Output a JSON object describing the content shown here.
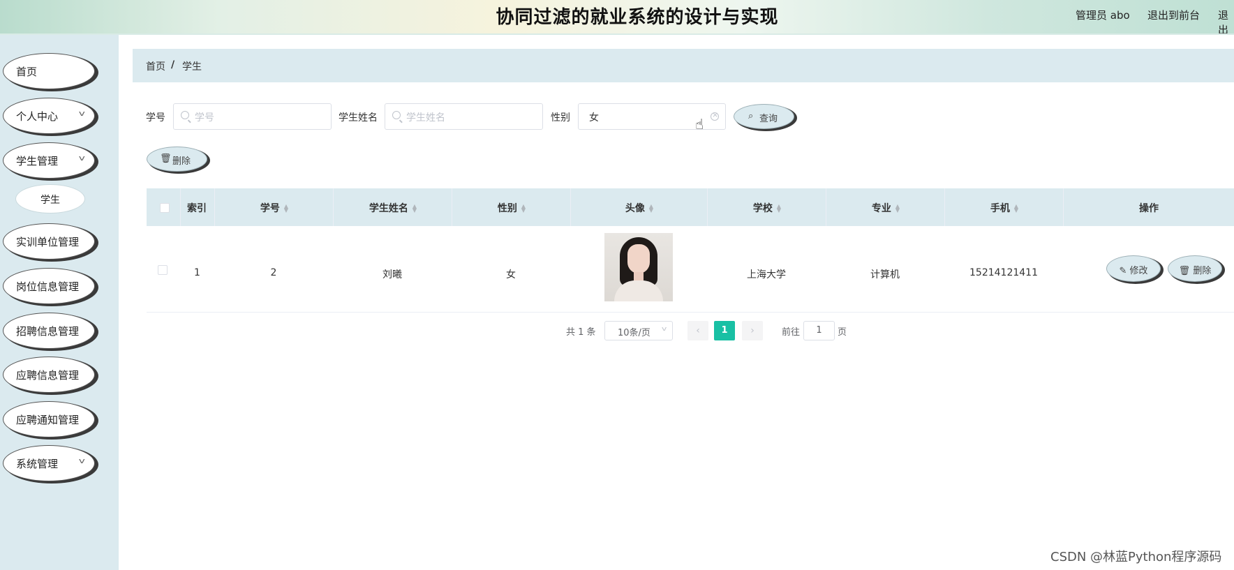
{
  "header": {
    "title": "协同过滤的就业系统的设计与实现",
    "user": "管理员 abo",
    "links": [
      "退出到前台",
      "退出"
    ]
  },
  "sidebar": {
    "items": [
      {
        "label": "首页",
        "expandable": false
      },
      {
        "label": "个人中心",
        "expandable": true
      },
      {
        "label": "学生管理",
        "expandable": true
      },
      {
        "label": "实训单位管理",
        "expandable": false
      },
      {
        "label": "岗位信息管理",
        "expandable": false
      },
      {
        "label": "招聘信息管理",
        "expandable": false
      },
      {
        "label": "应聘信息管理",
        "expandable": false
      },
      {
        "label": "应聘通知管理",
        "expandable": false
      },
      {
        "label": "系统管理",
        "expandable": true
      }
    ],
    "sub_item": "学生"
  },
  "breadcrumb": {
    "home": "首页",
    "separator": "/",
    "current": "学生"
  },
  "search": {
    "student_no_label": "学号",
    "student_no_placeholder": "学号",
    "name_label": "学生姓名",
    "name_placeholder": "学生姓名",
    "gender_label": "性别",
    "gender_value": "女",
    "query_button": "查询"
  },
  "toolbar": {
    "delete_button": "删除"
  },
  "table": {
    "headers": [
      "索引",
      "学号",
      "学生姓名",
      "性别",
      "头像",
      "学校",
      "专业",
      "手机",
      "操作"
    ],
    "rows": [
      {
        "index": "1",
        "student_no": "2",
        "name": "刘曦",
        "gender": "女",
        "school": "上海大学",
        "major": "计算机",
        "phone": "15214121411"
      }
    ],
    "edit_button": "修改",
    "delete_button": "删除"
  },
  "pagination": {
    "total": "共 1 条",
    "page_size": "10条/页",
    "current_page": "1",
    "goto_label": "前往",
    "goto_value": "1",
    "page_suffix": "页"
  },
  "watermark": "CSDN @林蓝Python程序源码",
  "colors": {
    "accent": "#19c0a4",
    "panel": "#dbeaef"
  }
}
